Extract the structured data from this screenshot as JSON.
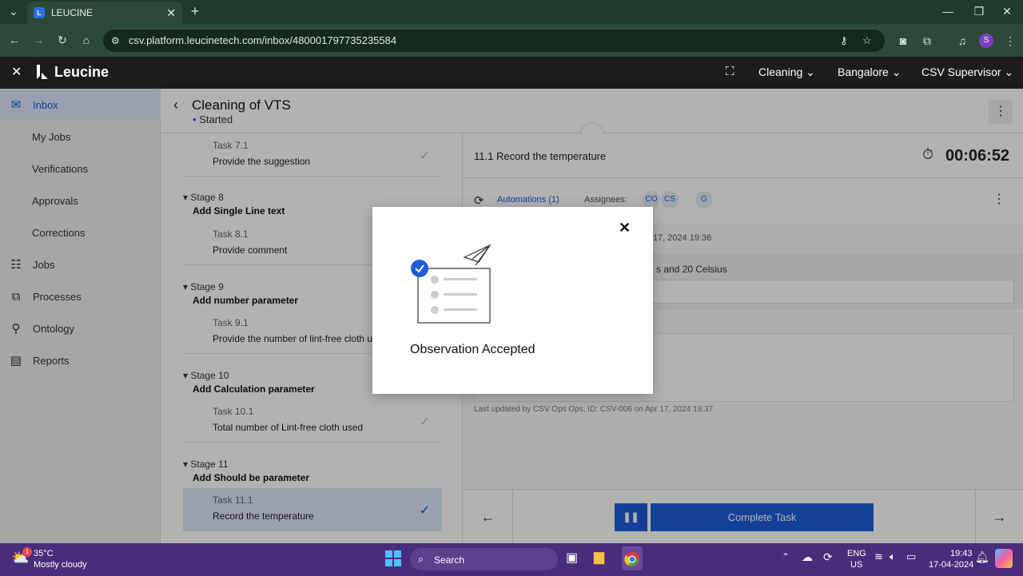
{
  "browser": {
    "tab_title": "LEUCINE",
    "url": "csv.platform.leucinetech.com/inbox/480001797735235584",
    "profile_initial": "S"
  },
  "app": {
    "logo_text": "Leucine",
    "facility": "Cleaning",
    "location": "Bangalore",
    "role": "CSV Supervisor"
  },
  "sidebar": {
    "items": [
      {
        "label": "Inbox",
        "icon": "inbox-icon"
      },
      {
        "label": "My Jobs"
      },
      {
        "label": "Verifications"
      },
      {
        "label": "Approvals"
      },
      {
        "label": "Corrections"
      },
      {
        "label": "Jobs",
        "icon": "clipboard-icon"
      },
      {
        "label": "Processes",
        "icon": "process-icon"
      },
      {
        "label": "Ontology",
        "icon": "hierarchy-icon"
      },
      {
        "label": "Reports",
        "icon": "report-icon"
      }
    ]
  },
  "job": {
    "title": "Cleaning of VTS",
    "status": "Started"
  },
  "stages": {
    "task71": {
      "num": "Task 7.1",
      "title": "Provide the suggestion"
    },
    "stage8": {
      "num": "Stage 8",
      "title": "Add Single Line text"
    },
    "task81": {
      "num": "Task 8.1",
      "title": "Provide comment"
    },
    "stage9": {
      "num": "Stage 9",
      "title": "Add number parameter"
    },
    "task91": {
      "num": "Task 9.1",
      "title": "Provide the number of lint-free cloth u"
    },
    "stage10": {
      "num": "Stage 10",
      "title": "Add Calculation parameter"
    },
    "task101": {
      "num": "Task 10.1",
      "title": "Total number of Lint-free cloth used"
    },
    "stage11": {
      "num": "Stage 11",
      "title": "Add Should be parameter"
    },
    "task111": {
      "num": "Task 11.1",
      "title": "Record the temperature"
    }
  },
  "task_panel": {
    "title": "11.1 Record the temperature",
    "timer": "00:06:52",
    "automations": "Automations (1)",
    "assignees_label": "Assignees:",
    "assignees": [
      "CO",
      "CS",
      "G"
    ],
    "partial_date": "pr 17, 2024 19:36",
    "partial_text": "s and 20 Celsius",
    "last_updated": "Last updated by CSV Ops Ops, ID: CSV-006 on Apr 17, 2024 19:37"
  },
  "footer": {
    "complete_label": "Complete Task"
  },
  "modal": {
    "message": "Observation Accepted"
  },
  "taskbar": {
    "temperature": "35°C",
    "weather": "Mostly cloudy",
    "search_placeholder": "Search",
    "lang1": "ENG",
    "lang2": "US",
    "time": "19:43",
    "date": "17-04-2024",
    "weather_badge": "1"
  }
}
